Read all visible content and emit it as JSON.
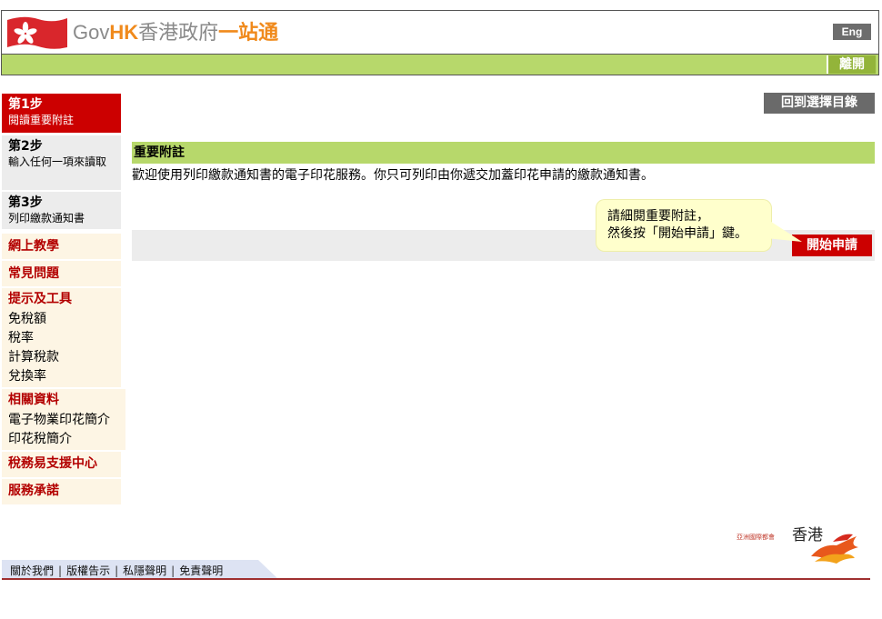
{
  "header": {
    "logo_gov": "Gov",
    "logo_hk": "HK",
    "logo_zh_grey": "香港政府",
    "logo_zh_orange": "一站通",
    "lang_button": "Eng",
    "exit_button": "離開"
  },
  "sidebar": {
    "steps": [
      {
        "title": "第1步",
        "desc": "閱讀重要附註"
      },
      {
        "title": "第2步",
        "desc": "輸入任何一項來讀取"
      },
      {
        "title": "第3步",
        "desc": "列印繳款通知書"
      }
    ],
    "tutorial": "網上教學",
    "faq": "常見問題",
    "tips": {
      "heading": "提示及工具",
      "items": [
        "免稅額",
        "稅率",
        "計算稅款",
        "兌換率"
      ]
    },
    "related": {
      "heading": "相關資料",
      "items": [
        "電子物業印花簡介",
        "印花稅簡介"
      ]
    },
    "tax_ease": "稅務易支援中心",
    "pledge": "服務承諾"
  },
  "main": {
    "back_button": "回到選擇目錄",
    "section_title": "重要附註",
    "intro": "歡迎使用列印繳款通知書的電子印花服務。你只可列印由你遞交加蓋印花申請的繳款通知書。",
    "tooltip_line1": "請細閱重要附註，",
    "tooltip_line2": "然後按「開始申請」鍵。",
    "start_button": "開始申請"
  },
  "footer": {
    "brand_small": "亞洲國際都會",
    "brand_zh": "香港",
    "links": [
      "關於我們",
      "版權告示",
      "私隱聲明",
      "免責聲明"
    ]
  },
  "colors": {
    "accent_red": "#cc0000",
    "green": "#b7d86b",
    "orange": "#f08a1c"
  }
}
